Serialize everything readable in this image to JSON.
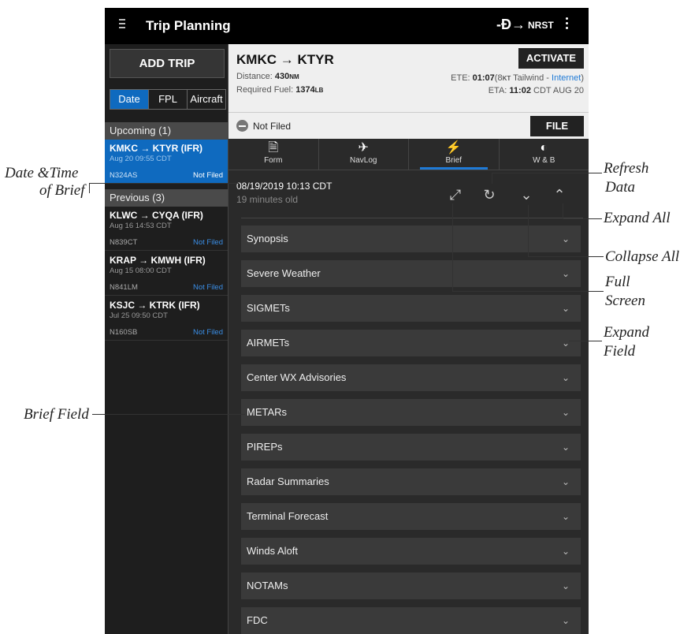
{
  "topbar": {
    "title": "Trip Planning",
    "nrst_label": "NRST"
  },
  "sidebar": {
    "add_trip_label": "ADD TRIP",
    "segments": [
      "Date",
      "FPL",
      "Aircraft"
    ],
    "upcoming_header": "Upcoming (1)",
    "previous_header": "Previous (3)",
    "trips": [
      {
        "route": "KMKC → KTYR (IFR)",
        "date": "Aug 20 09:55 CDT",
        "reg": "N324AS",
        "status": "Not Filed"
      },
      {
        "route": "KLWC → CYQA (IFR)",
        "date": "Aug 16 14:53 CDT",
        "reg": "N839CT",
        "status": "Not Filed"
      },
      {
        "route": "KRAP → KMWH (IFR)",
        "date": "Aug 15 08:00 CDT",
        "reg": "N841LM",
        "status": "Not Filed"
      },
      {
        "route": "KSJC → KTRK (IFR)",
        "date": "Jul 25 09:50 CDT",
        "reg": "N160SB",
        "status": "Not Filed"
      }
    ]
  },
  "trip": {
    "route": "KMKC → KTYR",
    "distance_label": "Distance: ",
    "distance_value": "430",
    "distance_unit": "NM",
    "fuel_label": "Required Fuel: ",
    "fuel_value": "1374",
    "fuel_unit": "LB",
    "activate_label": "ACTIVATE",
    "ete_label": "ETE: ",
    "ete_value": "01:07",
    "ete_detail_pre": "(8",
    "ete_detail_unit": "KT",
    "ete_detail_post": " Tailwind - ",
    "ete_source": "Internet",
    "ete_detail_end": ")",
    "eta_label": "ETA: ",
    "eta_value": "11:02",
    "eta_detail": " CDT AUG 20",
    "filed_status": "Not Filed",
    "file_label": "FILE"
  },
  "tabs": [
    {
      "label": "Form",
      "icon": "form-icon"
    },
    {
      "label": "NavLog",
      "icon": "navlog-icon"
    },
    {
      "label": "Brief",
      "icon": "brief-icon"
    },
    {
      "label": "W & B",
      "icon": "weight-balance-icon"
    }
  ],
  "brief": {
    "date": "08/19/2019 10:13 CDT",
    "age": "19 minutes old",
    "fields": [
      "Synopsis",
      "Severe Weather",
      "SIGMETs",
      "AIRMETs",
      "Center WX Advisories",
      "METARs",
      "PIREPs",
      "Radar Summaries",
      "Terminal Forecast",
      "Winds Aloft",
      "NOTAMs",
      "FDC"
    ]
  },
  "callouts": {
    "date_time_1": "Date &Time",
    "date_time_2": "of Brief",
    "brief_field": "Brief Field",
    "refresh_1": "Refresh",
    "refresh_2": "Data",
    "expand_all": "Expand All",
    "collapse_all": "Collapse All",
    "full_1": "Full",
    "full_2": "Screen",
    "expand_field_1": "Expand",
    "expand_field_2": "Field"
  },
  "colors": {
    "accent": "#0f6abf",
    "link": "#1f7ad6"
  }
}
